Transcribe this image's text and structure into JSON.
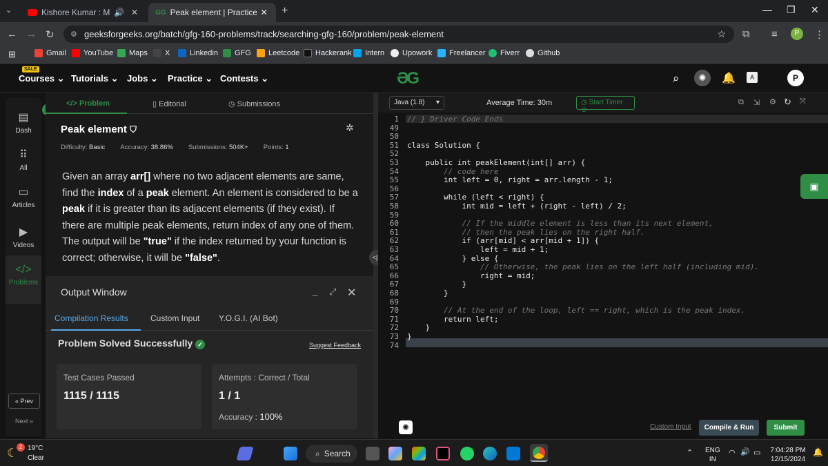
{
  "browser": {
    "tabs": [
      {
        "title": "Kishore Kumar : Mere Sapn",
        "audio_icon": "speaker-icon"
      },
      {
        "title": "Peak element | Practice | Geeksf"
      }
    ],
    "url": "geeksforgeeks.org/batch/gfg-160-problems/track/searching-gfg-160/problem/peak-element",
    "profile_initial": "P",
    "bookmarks": [
      "Gmail",
      "YouTube",
      "Maps",
      "X",
      "Linkedin",
      "GFG",
      "Leetcode",
      "Hackerank",
      "Intern",
      "Upowork",
      "Freelancer",
      "Fiverr",
      "Github"
    ]
  },
  "header": {
    "sale_badge": "SALE",
    "menu": [
      "Courses",
      "Tutorials",
      "Jobs",
      "Practice",
      "Contests"
    ],
    "avatar_initial": "P"
  },
  "sidebar": {
    "items": [
      "Dash",
      "All",
      "Articles",
      "Videos",
      "Problems"
    ],
    "prev": "« Prev",
    "next": "Next »"
  },
  "problem": {
    "tabs": [
      "</> Problem",
      "Editorial",
      "Submissions"
    ],
    "title": "Peak element",
    "difficulty_label": "Difficulty:",
    "difficulty": "Basic",
    "accuracy_label": "Accuracy:",
    "accuracy": "38.86%",
    "submissions_label": "Submissions:",
    "submissions": "504K+",
    "points_label": "Points:",
    "points": "1",
    "desc_1": "Given an array ",
    "desc_arr": "arr[]",
    "desc_2": " where no two adjacent elements are same, find the ",
    "desc_index": "index",
    "desc_3": " of a ",
    "desc_peak": "peak",
    "desc_4": " element. An element is considered to be a ",
    "desc_peak2": "peak",
    "desc_5": " if it is greater than its adjacent elements (if they exist). If there are multiple peak elements, return index of any one of them. The output will be ",
    "desc_true": "\"true\"",
    "desc_6": " if the index returned by your function is correct; otherwise, it will be ",
    "desc_false": "\"false\"",
    "desc_7": "."
  },
  "output": {
    "title": "Output Window",
    "tabs": [
      "Compilation Results",
      "Custom Input",
      "Y.O.G.I. (AI Bot)"
    ],
    "status": "Problem Solved Successfully",
    "feedback": "Suggest Feedback",
    "test_label": "Test Cases Passed",
    "test_value": "1115 / 1115",
    "attempts_label": "Attempts : Correct / Total",
    "attempts_value": "1 / 1",
    "accuracy_label": "Accuracy :",
    "accuracy_value": "100%"
  },
  "editor": {
    "language": "Java (1.8)",
    "avg_time": "Average Time: 30m",
    "timer": "Start Timer",
    "lines": [
      {
        "n": "1",
        "t": "// } Driver Code Ends",
        "c": "cm"
      },
      {
        "n": "49",
        "t": ""
      },
      {
        "n": "50",
        "t": ""
      },
      {
        "n": "51",
        "t": "class Solution {"
      },
      {
        "n": "52",
        "t": ""
      },
      {
        "n": "53",
        "t": "    public int peakElement(int[] arr) {"
      },
      {
        "n": "54",
        "t": "        // code here",
        "c": "cm"
      },
      {
        "n": "55",
        "t": "        int left = 0, right = arr.length - 1;"
      },
      {
        "n": "56",
        "t": ""
      },
      {
        "n": "57",
        "t": "        while (left < right) {"
      },
      {
        "n": "58",
        "t": "            int mid = left + (right - left) / 2;"
      },
      {
        "n": "59",
        "t": ""
      },
      {
        "n": "60",
        "t": "            // If the middle element is less than its next element,",
        "c": "cm"
      },
      {
        "n": "61",
        "t": "            // then the peak lies on the right half.",
        "c": "cm"
      },
      {
        "n": "62",
        "t": "            if (arr[mid] < arr[mid + 1]) {"
      },
      {
        "n": "63",
        "t": "                left = mid + 1;"
      },
      {
        "n": "64",
        "t": "            } else {"
      },
      {
        "n": "65",
        "t": "                // Otherwise, the peak lies on the left half (including mid).",
        "c": "cm"
      },
      {
        "n": "66",
        "t": "                right = mid;"
      },
      {
        "n": "67",
        "t": "            }"
      },
      {
        "n": "68",
        "t": "        }"
      },
      {
        "n": "69",
        "t": ""
      },
      {
        "n": "70",
        "t": "        // At the end of the loop, left == right, which is the peak index.",
        "c": "cm"
      },
      {
        "n": "71",
        "t": "        return left;"
      },
      {
        "n": "72",
        "t": "    }"
      },
      {
        "n": "73",
        "t": "}"
      },
      {
        "n": "74",
        "t": ""
      }
    ],
    "custom_input": "Custom Input",
    "compile_run": "Compile & Run",
    "submit": "Submit"
  },
  "taskbar": {
    "weather_temp": "19°C",
    "weather_desc": "Clear",
    "weather_badge": "2",
    "search": "Search",
    "lang_1": "ENG",
    "lang_2": "IN",
    "time": "7:04:28 PM",
    "date": "12/15/2024"
  }
}
